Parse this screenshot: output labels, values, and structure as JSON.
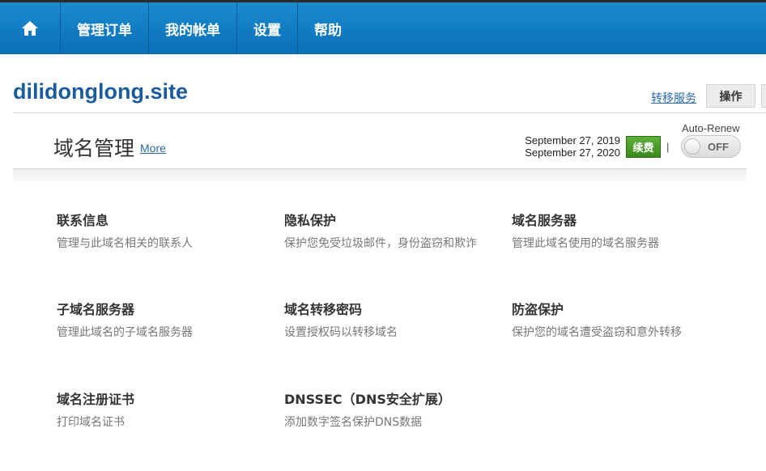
{
  "nav": {
    "home_icon": "home-icon",
    "items": [
      "管理订单",
      "我的帐单",
      "设置",
      "帮助"
    ]
  },
  "domain": {
    "name": "dilidonglong.site",
    "transfer_label": "转移服务",
    "action_label": "操作"
  },
  "section": {
    "title": "域名管理",
    "more_label": "More",
    "date_start": "September 27, 2019",
    "date_end": "September 27, 2020",
    "renew_label": "续费",
    "separator": "|",
    "autorenew_label": "Auto-Renew",
    "toggle_state": "OFF"
  },
  "features": [
    {
      "title": "联系信息",
      "desc": "管理与此域名相关的联系人"
    },
    {
      "title": "隐私保护",
      "desc": "保护您免受垃圾邮件，身份盗窃和欺诈"
    },
    {
      "title": "域名服务器",
      "desc": "管理此域名使用的域名服务器"
    },
    {
      "title": "子域名服务器",
      "desc": "管理此域名的子域名服务器"
    },
    {
      "title": "域名转移密码",
      "desc": "设置授权码以转移域名"
    },
    {
      "title": "防盗保护",
      "desc": "保护您的域名遭受盗窃和意外转移"
    },
    {
      "title": "域名注册证书",
      "desc": "打印域名证书"
    },
    {
      "title": "DNSSEC（DNS安全扩展）",
      "desc": "添加数字签名保护DNS数据"
    }
  ],
  "colors": {
    "nav_bg": "#0a7ac4",
    "domain_title": "#1a5c9e",
    "link": "#2a6aa8",
    "renew_green": "#4a9c28"
  }
}
